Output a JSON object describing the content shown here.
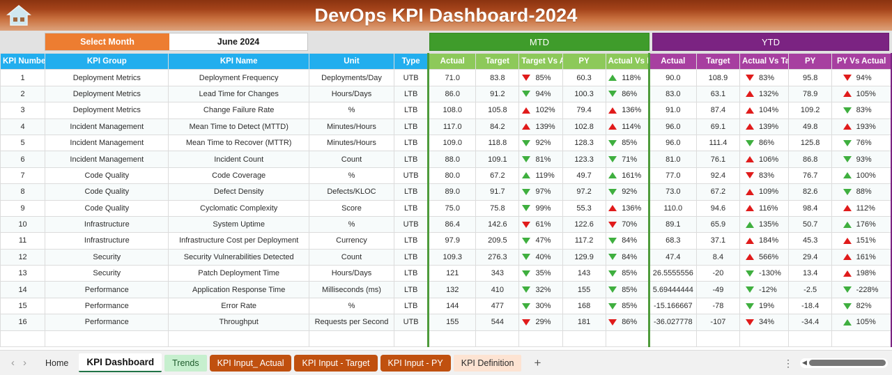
{
  "banner": {
    "title": "DevOps KPI Dashboard-2024",
    "home_icon": "home-icon"
  },
  "controls": {
    "select_month_label": "Select Month",
    "selected_month": "June 2024"
  },
  "groups": {
    "mtd": "MTD",
    "ytd": "YTD"
  },
  "columns": {
    "kpi_number": "KPI Number",
    "kpi_group": "KPI Group",
    "kpi_name": "KPI Name",
    "unit": "Unit",
    "type": "Type",
    "mtd": {
      "actual": "Actual",
      "target": "Target",
      "target_vs_actual": "Target Vs Actual",
      "py": "PY",
      "actual_vs_py": "Actual Vs PY"
    },
    "ytd": {
      "actual": "Actual",
      "target": "Target",
      "actual_vs_target": "Actual Vs Target",
      "py": "PY",
      "py_vs_actual": "PY Vs Actual"
    }
  },
  "colors": {
    "banner_start": "#8a3310",
    "banner_end": "#dda27c",
    "header_blue": "#22aeee",
    "mtd_dark": "#3f9c2b",
    "mtd_light": "#8dc95a",
    "ytd_dark": "#7b2382",
    "ytd_light": "#a73fa0",
    "orange": "#ed7d31",
    "up_red": "#e01b1b",
    "up_green": "#3faf3f",
    "down_red": "#e01b1b",
    "down_green": "#3faf3f"
  },
  "rows": [
    {
      "n": "1",
      "group": "Deployment Metrics",
      "name": "Deployment Frequency",
      "unit": "Deployments/Day",
      "type": "UTB",
      "mtd": {
        "actual": "71.0",
        "target": "83.8",
        "tva_dir": "down",
        "tva_color": "red",
        "tva": "85%",
        "py": "60.3",
        "avp_dir": "up",
        "avp_color": "green",
        "avp": "118%"
      },
      "ytd": {
        "actual": "90.0",
        "target": "108.9",
        "avt_dir": "down",
        "avt_color": "red",
        "avt": "83%",
        "py": "95.8",
        "pva_dir": "down",
        "pva_color": "red",
        "pva": "94%"
      }
    },
    {
      "n": "2",
      "group": "Deployment Metrics",
      "name": "Lead Time for Changes",
      "unit": "Hours/Days",
      "type": "LTB",
      "mtd": {
        "actual": "86.0",
        "target": "91.2",
        "tva_dir": "down",
        "tva_color": "green",
        "tva": "94%",
        "py": "100.3",
        "avp_dir": "down",
        "avp_color": "green",
        "avp": "86%"
      },
      "ytd": {
        "actual": "83.0",
        "target": "63.1",
        "avt_dir": "up",
        "avt_color": "red",
        "avt": "132%",
        "py": "78.9",
        "pva_dir": "up",
        "pva_color": "red",
        "pva": "105%"
      }
    },
    {
      "n": "3",
      "group": "Deployment Metrics",
      "name": "Change Failure Rate",
      "unit": "%",
      "type": "LTB",
      "mtd": {
        "actual": "108.0",
        "target": "105.8",
        "tva_dir": "up",
        "tva_color": "red",
        "tva": "102%",
        "py": "79.4",
        "avp_dir": "up",
        "avp_color": "red",
        "avp": "136%"
      },
      "ytd": {
        "actual": "91.0",
        "target": "87.4",
        "avt_dir": "up",
        "avt_color": "red",
        "avt": "104%",
        "py": "109.2",
        "pva_dir": "down",
        "pva_color": "green",
        "pva": "83%"
      }
    },
    {
      "n": "4",
      "group": "Incident Management",
      "name": "Mean Time to Detect (MTTD)",
      "unit": "Minutes/Hours",
      "type": "LTB",
      "mtd": {
        "actual": "117.0",
        "target": "84.2",
        "tva_dir": "up",
        "tva_color": "red",
        "tva": "139%",
        "py": "102.8",
        "avp_dir": "up",
        "avp_color": "red",
        "avp": "114%"
      },
      "ytd": {
        "actual": "96.0",
        "target": "69.1",
        "avt_dir": "up",
        "avt_color": "red",
        "avt": "139%",
        "py": "49.8",
        "pva_dir": "up",
        "pva_color": "red",
        "pva": "193%"
      }
    },
    {
      "n": "5",
      "group": "Incident Management",
      "name": "Mean Time to Recover (MTTR)",
      "unit": "Minutes/Hours",
      "type": "LTB",
      "mtd": {
        "actual": "109.0",
        "target": "118.8",
        "tva_dir": "down",
        "tva_color": "green",
        "tva": "92%",
        "py": "128.3",
        "avp_dir": "down",
        "avp_color": "green",
        "avp": "85%"
      },
      "ytd": {
        "actual": "96.0",
        "target": "111.4",
        "avt_dir": "down",
        "avt_color": "green",
        "avt": "86%",
        "py": "125.8",
        "pva_dir": "down",
        "pva_color": "green",
        "pva": "76%"
      }
    },
    {
      "n": "6",
      "group": "Incident Management",
      "name": "Incident Count",
      "unit": "Count",
      "type": "LTB",
      "mtd": {
        "actual": "88.0",
        "target": "109.1",
        "tva_dir": "down",
        "tva_color": "green",
        "tva": "81%",
        "py": "123.3",
        "avp_dir": "down",
        "avp_color": "green",
        "avp": "71%"
      },
      "ytd": {
        "actual": "81.0",
        "target": "76.1",
        "avt_dir": "up",
        "avt_color": "red",
        "avt": "106%",
        "py": "86.8",
        "pva_dir": "down",
        "pva_color": "green",
        "pva": "93%"
      }
    },
    {
      "n": "7",
      "group": "Code Quality",
      "name": "Code Coverage",
      "unit": "%",
      "type": "UTB",
      "mtd": {
        "actual": "80.0",
        "target": "67.2",
        "tva_dir": "up",
        "tva_color": "green",
        "tva": "119%",
        "py": "49.7",
        "avp_dir": "up",
        "avp_color": "green",
        "avp": "161%"
      },
      "ytd": {
        "actual": "77.0",
        "target": "92.4",
        "avt_dir": "down",
        "avt_color": "red",
        "avt": "83%",
        "py": "76.7",
        "pva_dir": "up",
        "pva_color": "green",
        "pva": "100%"
      }
    },
    {
      "n": "8",
      "group": "Code Quality",
      "name": "Defect Density",
      "unit": "Defects/KLOC",
      "type": "LTB",
      "mtd": {
        "actual": "89.0",
        "target": "91.7",
        "tva_dir": "down",
        "tva_color": "green",
        "tva": "97%",
        "py": "97.2",
        "avp_dir": "down",
        "avp_color": "green",
        "avp": "92%"
      },
      "ytd": {
        "actual": "73.0",
        "target": "67.2",
        "avt_dir": "up",
        "avt_color": "red",
        "avt": "109%",
        "py": "82.6",
        "pva_dir": "down",
        "pva_color": "green",
        "pva": "88%"
      }
    },
    {
      "n": "9",
      "group": "Code Quality",
      "name": "Cyclomatic Complexity",
      "unit": "Score",
      "type": "LTB",
      "mtd": {
        "actual": "75.0",
        "target": "75.8",
        "tva_dir": "down",
        "tva_color": "green",
        "tva": "99%",
        "py": "55.3",
        "avp_dir": "up",
        "avp_color": "red",
        "avp": "136%"
      },
      "ytd": {
        "actual": "110.0",
        "target": "94.6",
        "avt_dir": "up",
        "avt_color": "red",
        "avt": "116%",
        "py": "98.4",
        "pva_dir": "up",
        "pva_color": "red",
        "pva": "112%"
      }
    },
    {
      "n": "10",
      "group": "Infrastructure",
      "name": "System Uptime",
      "unit": "%",
      "type": "UTB",
      "mtd": {
        "actual": "86.4",
        "target": "142.6",
        "tva_dir": "down",
        "tva_color": "red",
        "tva": "61%",
        "py": "122.6",
        "avp_dir": "down",
        "avp_color": "red",
        "avp": "70%"
      },
      "ytd": {
        "actual": "89.1",
        "target": "65.9",
        "avt_dir": "up",
        "avt_color": "green",
        "avt": "135%",
        "py": "50.7",
        "pva_dir": "up",
        "pva_color": "green",
        "pva": "176%"
      }
    },
    {
      "n": "11",
      "group": "Infrastructure",
      "name": "Infrastructure Cost per Deployment",
      "unit": "Currency",
      "type": "LTB",
      "mtd": {
        "actual": "97.9",
        "target": "209.5",
        "tva_dir": "down",
        "tva_color": "green",
        "tva": "47%",
        "py": "117.2",
        "avp_dir": "down",
        "avp_color": "green",
        "avp": "84%"
      },
      "ytd": {
        "actual": "68.3",
        "target": "37.1",
        "avt_dir": "up",
        "avt_color": "red",
        "avt": "184%",
        "py": "45.3",
        "pva_dir": "up",
        "pva_color": "red",
        "pva": "151%"
      }
    },
    {
      "n": "12",
      "group": "Security",
      "name": "Security Vulnerabilities Detected",
      "unit": "Count",
      "type": "LTB",
      "mtd": {
        "actual": "109.3",
        "target": "276.3",
        "tva_dir": "down",
        "tva_color": "green",
        "tva": "40%",
        "py": "129.9",
        "avp_dir": "down",
        "avp_color": "green",
        "avp": "84%"
      },
      "ytd": {
        "actual": "47.4",
        "target": "8.4",
        "avt_dir": "up",
        "avt_color": "red",
        "avt": "566%",
        "py": "29.4",
        "pva_dir": "up",
        "pva_color": "red",
        "pva": "161%"
      }
    },
    {
      "n": "13",
      "group": "Security",
      "name": "Patch Deployment Time",
      "unit": "Hours/Days",
      "type": "LTB",
      "mtd": {
        "actual": "121",
        "target": "343",
        "tva_dir": "down",
        "tva_color": "green",
        "tva": "35%",
        "py": "143",
        "avp_dir": "down",
        "avp_color": "green",
        "avp": "85%"
      },
      "ytd": {
        "actual": "26.5555556",
        "target": "-20",
        "avt_dir": "down",
        "avt_color": "green",
        "avt": "-130%",
        "py": "13.4",
        "pva_dir": "up",
        "pva_color": "red",
        "pva": "198%"
      }
    },
    {
      "n": "14",
      "group": "Performance",
      "name": "Application Response Time",
      "unit": "Milliseconds (ms)",
      "type": "LTB",
      "mtd": {
        "actual": "132",
        "target": "410",
        "tva_dir": "down",
        "tva_color": "green",
        "tva": "32%",
        "py": "155",
        "avp_dir": "down",
        "avp_color": "green",
        "avp": "85%"
      },
      "ytd": {
        "actual": "5.69444444",
        "target": "-49",
        "avt_dir": "down",
        "avt_color": "green",
        "avt": "-12%",
        "py": "-2.5",
        "pva_dir": "down",
        "pva_color": "green",
        "pva": "-228%"
      }
    },
    {
      "n": "15",
      "group": "Performance",
      "name": "Error Rate",
      "unit": "%",
      "type": "LTB",
      "mtd": {
        "actual": "144",
        "target": "477",
        "tva_dir": "down",
        "tva_color": "green",
        "tva": "30%",
        "py": "168",
        "avp_dir": "down",
        "avp_color": "green",
        "avp": "85%"
      },
      "ytd": {
        "actual": "-15.166667",
        "target": "-78",
        "avt_dir": "down",
        "avt_color": "green",
        "avt": "19%",
        "py": "-18.4",
        "pva_dir": "down",
        "pva_color": "green",
        "pva": "82%"
      }
    },
    {
      "n": "16",
      "group": "Performance",
      "name": "Throughput",
      "unit": "Requests per Second",
      "type": "UTB",
      "mtd": {
        "actual": "155",
        "target": "544",
        "tva_dir": "down",
        "tva_color": "red",
        "tva": "29%",
        "py": "181",
        "avp_dir": "down",
        "avp_color": "red",
        "avp": "86%"
      },
      "ytd": {
        "actual": "-36.027778",
        "target": "-107",
        "avt_dir": "down",
        "avt_color": "red",
        "avt": "34%",
        "py": "-34.4",
        "pva_dir": "up",
        "pva_color": "green",
        "pva": "105%"
      }
    }
  ],
  "tabbar": {
    "prev": "‹",
    "next": "›",
    "tabs": [
      {
        "label": "Home",
        "style": "plain"
      },
      {
        "label": "KPI Dashboard",
        "style": "active"
      },
      {
        "label": "Trends",
        "style": "green"
      },
      {
        "label": "KPI Input_ Actual",
        "style": "orange"
      },
      {
        "label": "KPI Input - Target",
        "style": "orange"
      },
      {
        "label": "KPI Input - PY",
        "style": "orange"
      },
      {
        "label": "KPI Definition",
        "style": "peach"
      }
    ],
    "add_label": "+",
    "kebab": "⋮",
    "scroll_left": "◀"
  }
}
